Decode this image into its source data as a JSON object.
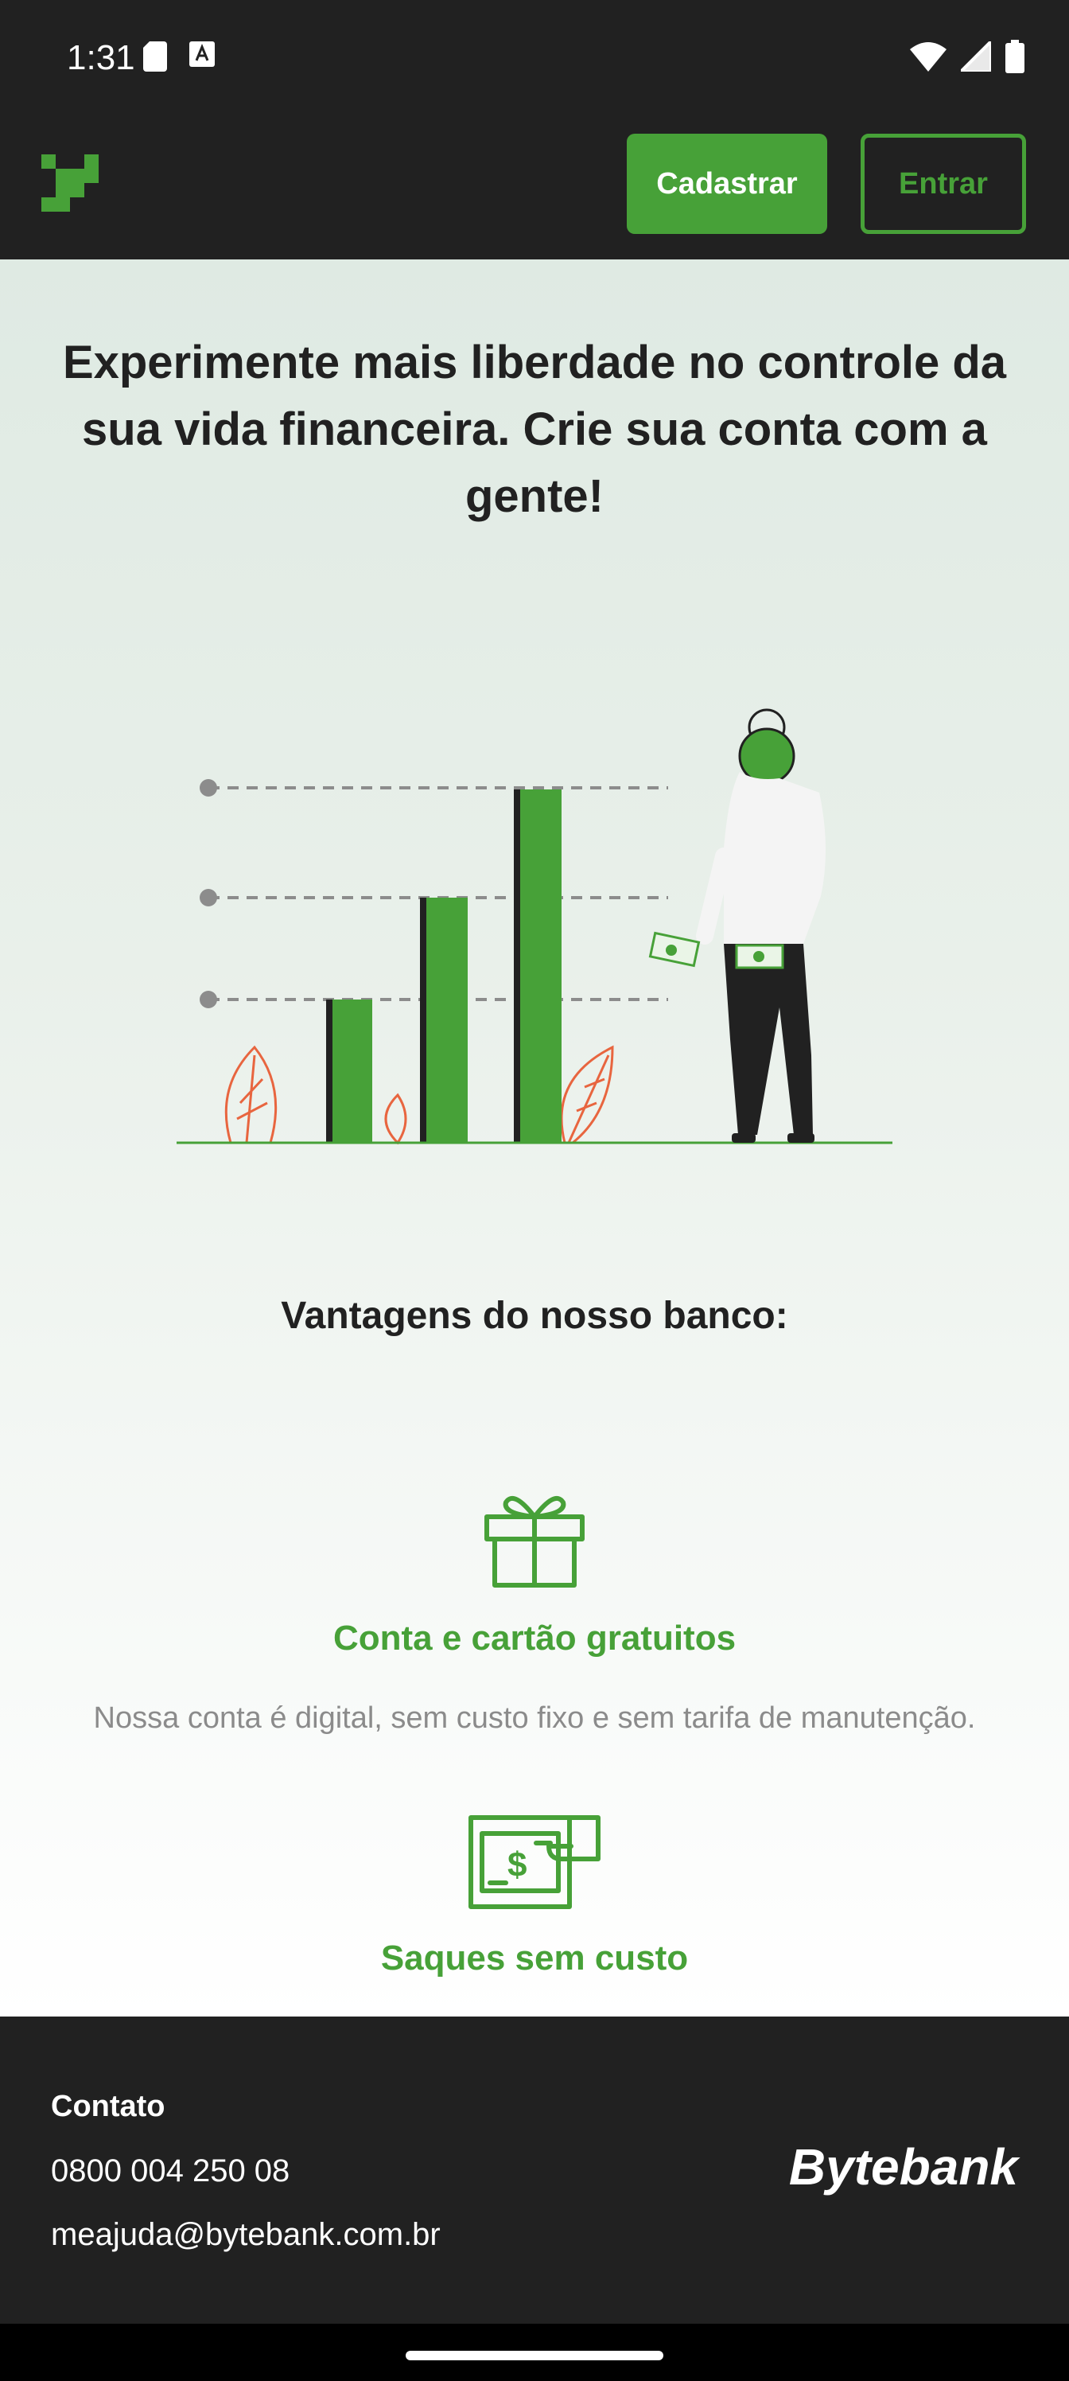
{
  "status_bar": {
    "time": "1:31",
    "left_icons": [
      "sd-card-icon",
      "keyboard-a-icon"
    ],
    "right_icons": [
      "wifi-icon",
      "signal-icon",
      "battery-icon"
    ]
  },
  "header": {
    "logo_icon": "bytebank-pixel-logo",
    "signup_label": "Cadastrar",
    "login_label": "Entrar"
  },
  "hero": {
    "title": "Experimente mais liberdade no controle da sua vida financeira. Crie sua conta com a gente!"
  },
  "advantages": {
    "title": "Vantagens do nosso banco:",
    "items": [
      {
        "icon": "gift-icon",
        "title": "Conta e cartão gratuitos",
        "description": "Nossa conta é digital, sem custo fixo e sem tarifa de manutenção."
      },
      {
        "icon": "cash-withdraw-icon",
        "title": "Saques sem custo"
      }
    ]
  },
  "footer": {
    "contact_heading": "Contato",
    "phone": "0800 004 250 08",
    "email": "meajuda@bytebank.com.br",
    "brand": "Bytebank"
  },
  "colors": {
    "accent_green": "#47a138",
    "dark": "#212121",
    "muted_text": "#8b8b8b"
  }
}
